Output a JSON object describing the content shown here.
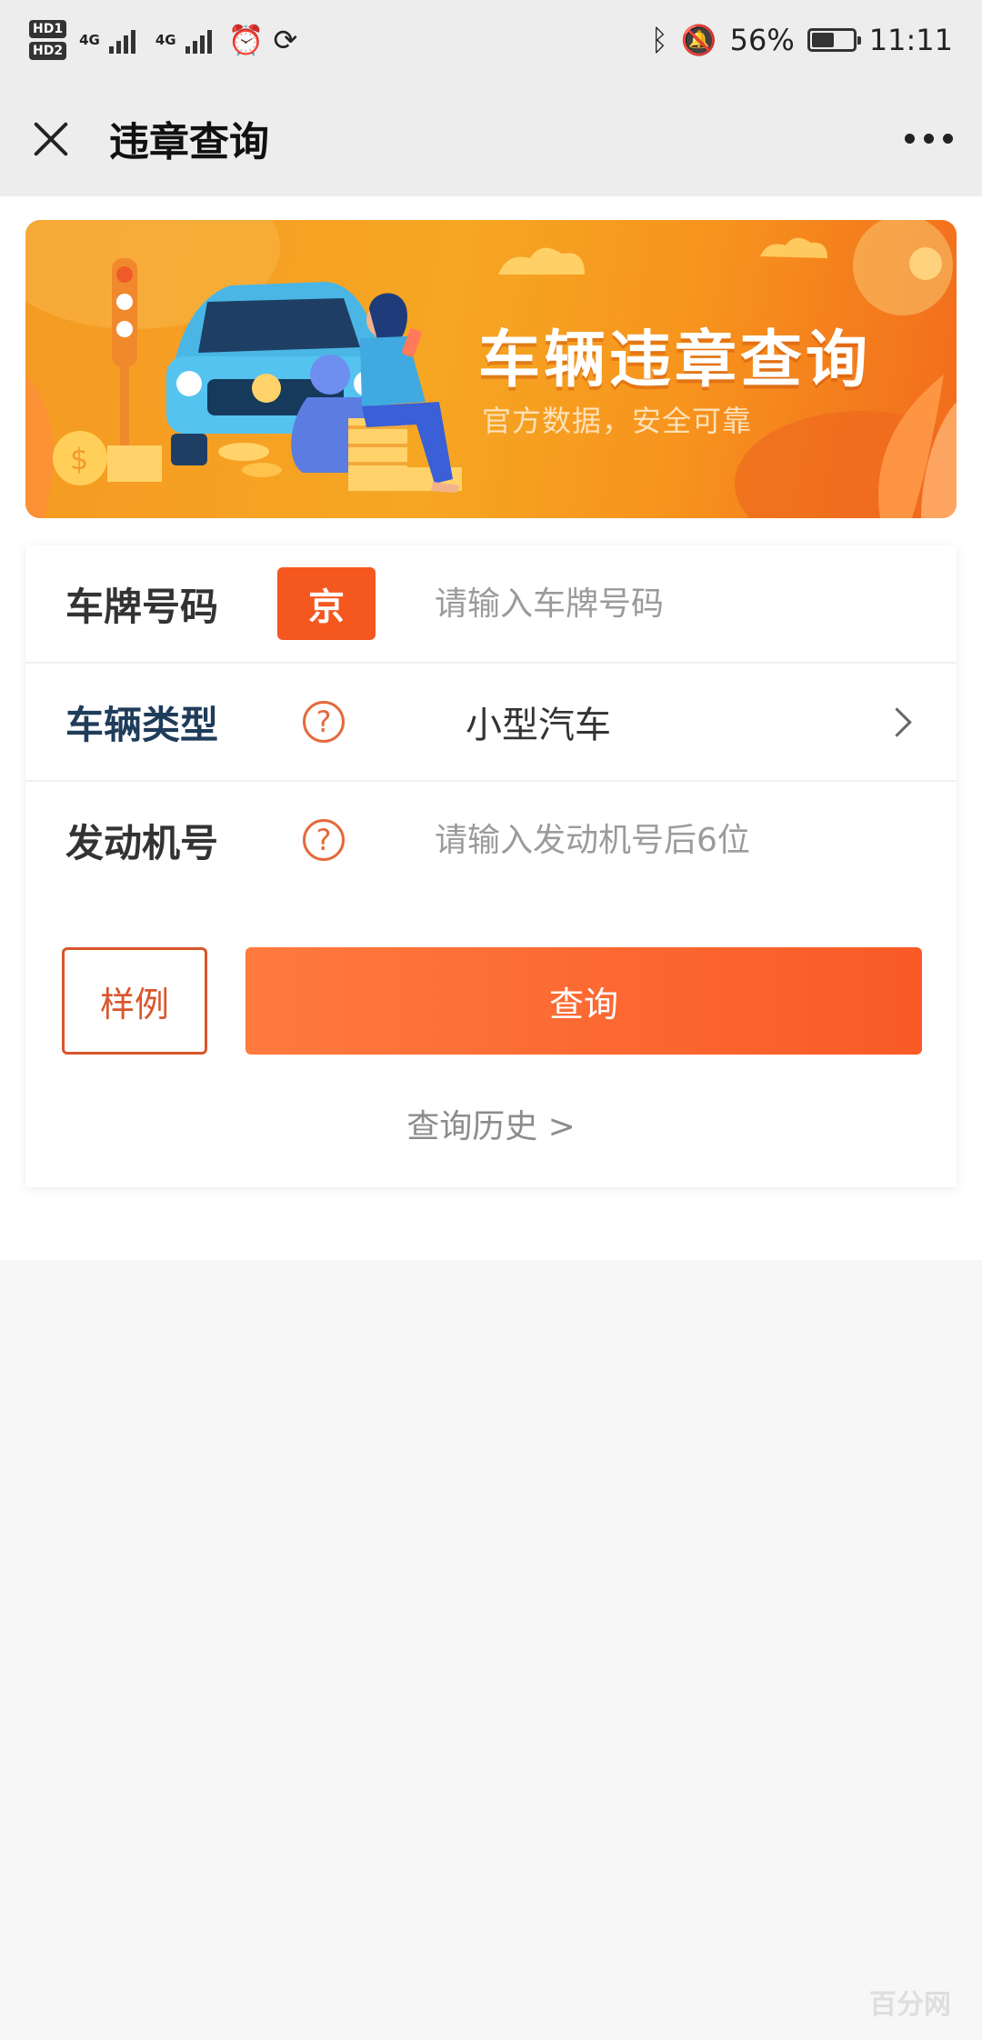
{
  "status_bar": {
    "hd1": "HD1",
    "hd2": "HD2",
    "net1": "4G",
    "net2": "4G",
    "battery_percent": "56%",
    "battery_level": 0.56,
    "time": "11:11",
    "icons": [
      "signal-icon",
      "alarm-icon",
      "sync-icon",
      "bluetooth-icon",
      "mute-icon",
      "battery-icon"
    ]
  },
  "header": {
    "title": "违章查询",
    "icons": [
      "close-icon",
      "more-icon"
    ]
  },
  "banner": {
    "title": "车辆违章查询",
    "subtitle": "官方数据，安全可靠"
  },
  "form": {
    "plate": {
      "label": "车牌号码",
      "province": "京",
      "placeholder": "请输入车牌号码",
      "value": ""
    },
    "vehicle_type": {
      "label": "车辆类型",
      "value": "小型汽车",
      "help_icon": "question-icon",
      "chevron_icon": "chevron-right-icon"
    },
    "engine": {
      "label": "发动机号",
      "placeholder": "请输入发动机号后6位",
      "value": "",
      "help_icon": "question-icon"
    },
    "example_button": "样例",
    "query_button": "查询",
    "history_link": "查询历史 >"
  },
  "colors": {
    "accent": "#f4581f",
    "label_blue": "#1f3c5a",
    "banner_orange": "#f59a23"
  },
  "watermark": "百分网"
}
